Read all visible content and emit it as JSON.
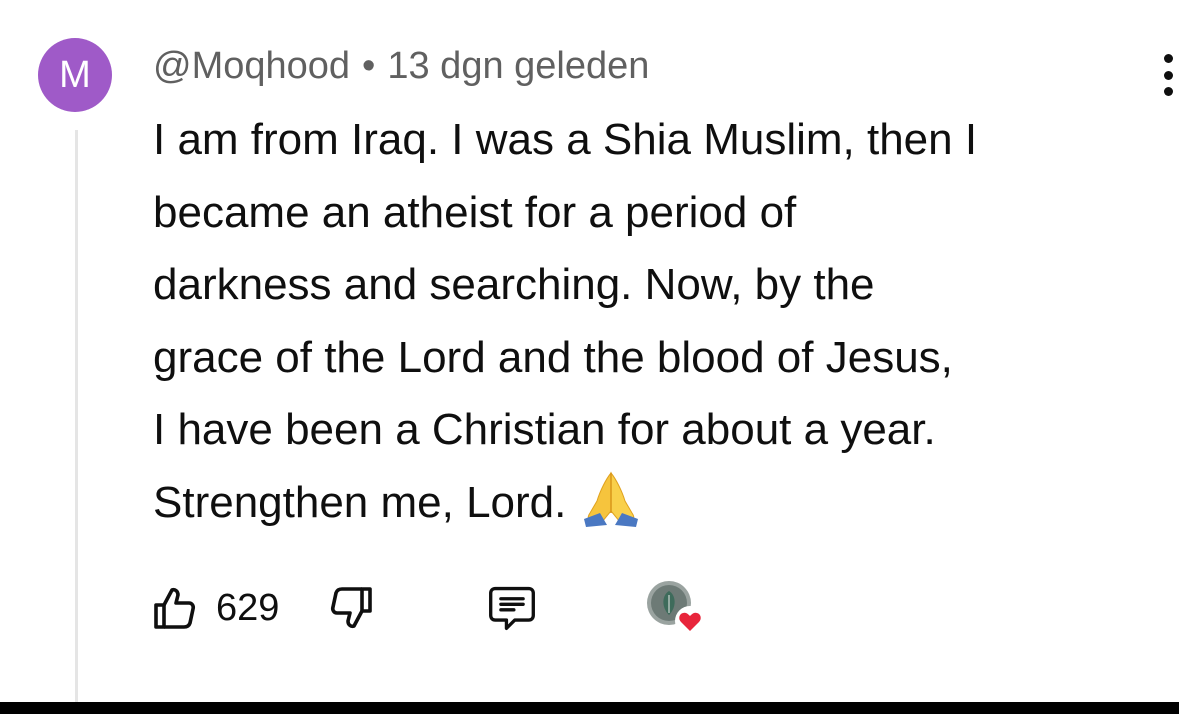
{
  "comment": {
    "avatar_letter": "M",
    "username": "@Moqhood",
    "separator": "•",
    "timestamp": "13 dgn geleden",
    "text_lines": [
      "I am from Iraq. I was a Shia Muslim, then I",
      "became an atheist for a period of",
      "darkness and searching. Now, by the",
      "grace of the Lord and the blood of Jesus,",
      "I have been a Christian for about a year.",
      "Strengthen me, Lord."
    ],
    "emoji": "folded-hands-emoji"
  },
  "actions": {
    "like_icon": "thumbs-up-icon",
    "like_count": "629",
    "dislike_icon": "thumbs-down-icon",
    "reply_icon": "reply-comment-icon",
    "creator_heart_icon": "creator-heart-icon"
  },
  "more_menu_icon": "more-vertical-icon",
  "colors": {
    "avatar_bg": "#9f5ac8",
    "meta_text": "#606060",
    "heart": "#e8253b"
  }
}
